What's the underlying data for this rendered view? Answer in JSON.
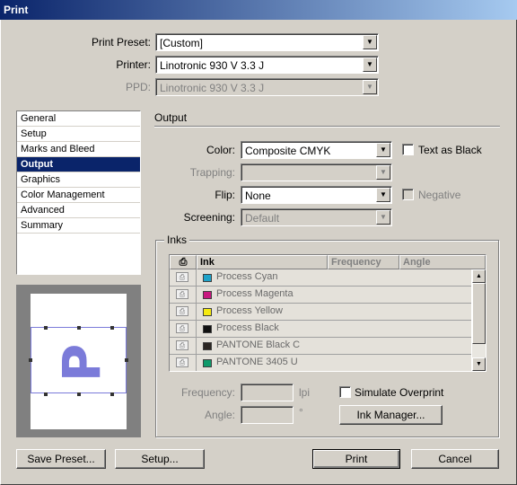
{
  "window": {
    "title": "Print"
  },
  "top": {
    "preset_label": "Print Preset:",
    "preset_value": "[Custom]",
    "printer_label": "Printer:",
    "printer_value": "Linotronic 930 V 3.3 J",
    "ppd_label": "PPD:",
    "ppd_value": "Linotronic 930 V 3.3 J"
  },
  "sidebar": {
    "items": [
      {
        "label": "General"
      },
      {
        "label": "Setup"
      },
      {
        "label": "Marks and Bleed"
      },
      {
        "label": "Output"
      },
      {
        "label": "Graphics"
      },
      {
        "label": "Color Management"
      },
      {
        "label": "Advanced"
      },
      {
        "label": "Summary"
      }
    ],
    "selected": "Output"
  },
  "preview": {
    "glyph": "P",
    "glyph_color": "#7b7bd9"
  },
  "output": {
    "heading": "Output",
    "color_label": "Color:",
    "color_value": "Composite CMYK",
    "text_as_black_label": "Text as Black",
    "trapping_label": "Trapping:",
    "trapping_value": "",
    "flip_label": "Flip:",
    "flip_value": "None",
    "negative_label": "Negative",
    "screening_label": "Screening:",
    "screening_value": "Default"
  },
  "inks": {
    "group_label": "Inks",
    "columns": [
      "Ink",
      "Frequency",
      "Angle"
    ],
    "rows": [
      {
        "name": "Process Cyan",
        "color": "#1fa3c9"
      },
      {
        "name": "Process Magenta",
        "color": "#c8187f"
      },
      {
        "name": "Process Yellow",
        "color": "#f5ea10"
      },
      {
        "name": "Process Black",
        "color": "#111111"
      },
      {
        "name": "PANTONE Black C",
        "color": "#2b2622"
      },
      {
        "name": "PANTONE 3405 U",
        "color": "#0f9a6a"
      }
    ],
    "frequency_label": "Frequency:",
    "frequency_unit": "lpi",
    "angle_label": "Angle:",
    "angle_unit": "°",
    "simulate_overprint_label": "Simulate Overprint",
    "ink_manager_label": "Ink Manager..."
  },
  "buttons": {
    "save_preset": "Save Preset...",
    "setup": "Setup...",
    "print": "Print",
    "cancel": "Cancel"
  },
  "glyphs": {
    "down_arrow": "▼",
    "up_arrow": "▲",
    "printer_icon": "⎙"
  }
}
